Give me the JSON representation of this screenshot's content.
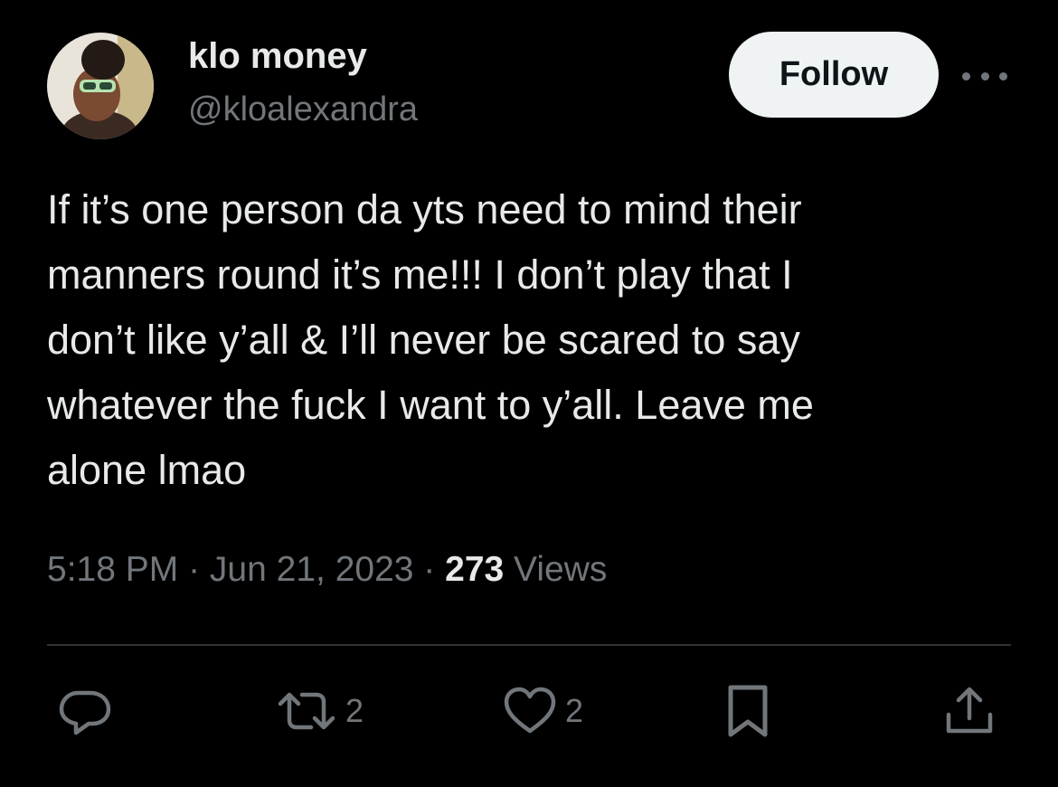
{
  "author": {
    "display_name": "klo money",
    "handle": "@kloalexandra"
  },
  "follow_button": {
    "label": "Follow"
  },
  "tweet": {
    "lines": [
      "If it’s one person da yts need to mind their",
      "manners round it’s me!!! I don’t play that I",
      "don’t like y’all & I’ll never be scared to say",
      "whatever the fuck I want to y’all. Leave me",
      "alone lmao"
    ]
  },
  "meta": {
    "time": "5:18 PM",
    "separator": " · ",
    "date": "Jun 21, 2023",
    "views_count": "273",
    "views_label": " Views"
  },
  "actions": {
    "reply": {
      "icon": "reply-icon"
    },
    "repost": {
      "icon": "repost-icon",
      "count": "2"
    },
    "like": {
      "icon": "heart-icon",
      "count": "2"
    },
    "bookmark": {
      "icon": "bookmark-icon"
    },
    "share": {
      "icon": "share-icon"
    }
  },
  "colors": {
    "background": "#000000",
    "text_primary": "#e7e9ea",
    "text_secondary": "#71767b",
    "follow_button_bg": "#eff3f4",
    "divider": "#2f3336"
  }
}
